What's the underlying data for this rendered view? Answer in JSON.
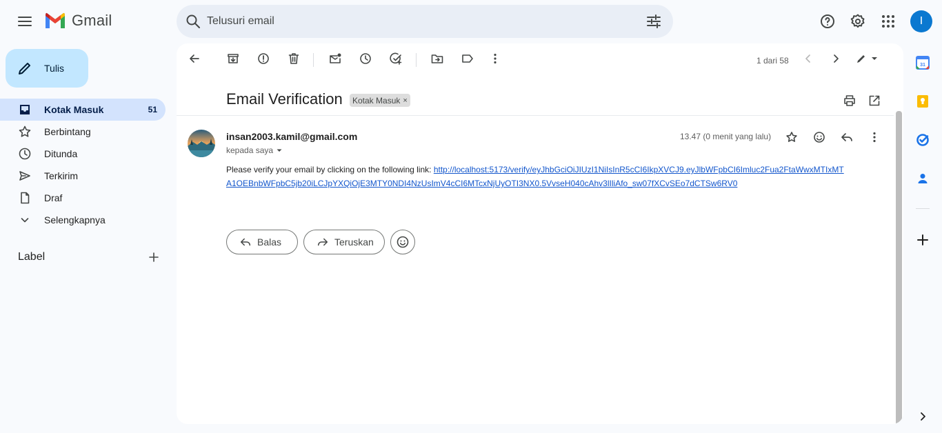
{
  "app": {
    "name": "Gmail"
  },
  "search": {
    "placeholder": "Telusuri email"
  },
  "user": {
    "initial": "I"
  },
  "compose": {
    "label": "Tulis"
  },
  "nav": [
    {
      "label": "Kotak Masuk",
      "count": "51",
      "icon": "inbox-icon"
    },
    {
      "label": "Berbintang",
      "icon": "star-icon"
    },
    {
      "label": "Ditunda",
      "icon": "clock-icon"
    },
    {
      "label": "Terkirim",
      "icon": "send-icon"
    },
    {
      "label": "Draf",
      "icon": "draft-icon"
    },
    {
      "label": "Selengkapnya",
      "icon": "chevron-down-icon"
    }
  ],
  "labels": {
    "title": "Label"
  },
  "toolbar": {
    "pager": "1 dari 58"
  },
  "email": {
    "subject": "Email Verification",
    "tag": "Kotak Masuk",
    "sender": "insan2003.kamil@gmail.com",
    "to": "kepada saya",
    "time": "13.47 (0 menit yang lalu)",
    "body_intro": "Please verify your email by clicking on the following link: ",
    "link": "http://localhost:5173/verify/eyJhbGciOiJIUzI1NiIsInR5cCI6IkpXVCJ9.eyJlbWFpbCI6Imluc2Fua2FtaWwxMTIxMTA1OEBnbWFpbC5jb20iLCJpYXQiOjE3MTY0NDI4NzUsImV4cCI6MTcxNjUyOTI3NX0.5VvseH040cAhv3lIliAfo_sw07fXCvSEo7dCTSw6RV0"
  },
  "reply": {
    "reply_label": "Balas",
    "forward_label": "Teruskan"
  },
  "colors": {
    "compose_bg": "#c2e7ff",
    "active_nav": "#d3e3fd",
    "link": "#1155cc",
    "search_bg": "#e9eef6"
  }
}
